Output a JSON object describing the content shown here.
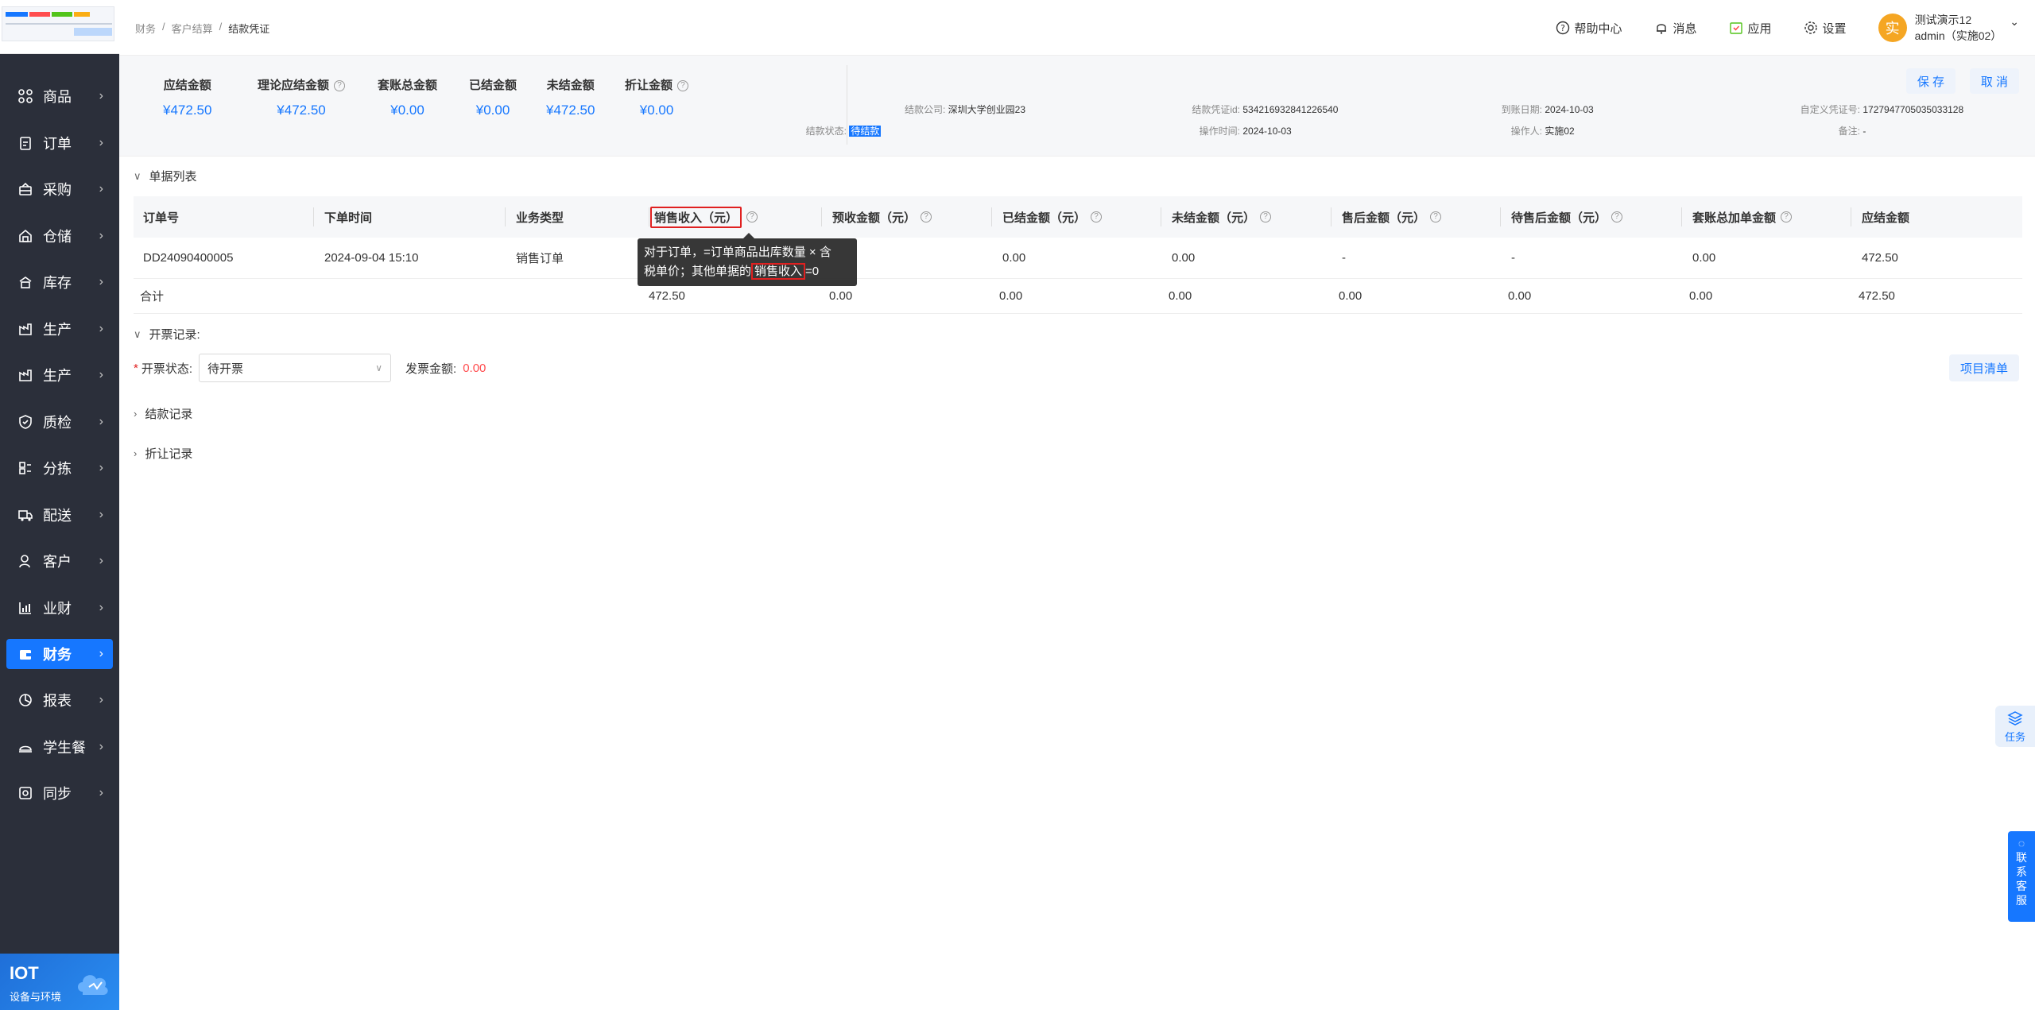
{
  "breadcrumb": [
    "财务",
    "客户结算",
    "结款凭证"
  ],
  "header": {
    "help": "帮助中心",
    "messages": "消息",
    "apps": "应用",
    "settings": "设置",
    "avatar_char": "实",
    "user_name": "测试演示12",
    "user_role": "admin（实施02）"
  },
  "sidebar": {
    "items": [
      {
        "label": "商品",
        "icon": "grid-icon"
      },
      {
        "label": "订单",
        "icon": "clipboard-icon"
      },
      {
        "label": "采购",
        "icon": "basket-icon"
      },
      {
        "label": "仓储",
        "icon": "warehouse-icon"
      },
      {
        "label": "库存",
        "icon": "inventory-icon"
      },
      {
        "label": "生产",
        "icon": "factory-icon"
      },
      {
        "label": "生产",
        "icon": "factory-icon"
      },
      {
        "label": "质检",
        "icon": "shield-icon"
      },
      {
        "label": "分拣",
        "icon": "sort-icon"
      },
      {
        "label": "配送",
        "icon": "truck-icon"
      },
      {
        "label": "客户",
        "icon": "user-icon"
      },
      {
        "label": "业财",
        "icon": "chart-icon"
      },
      {
        "label": "财务",
        "icon": "wallet-icon",
        "active": true
      },
      {
        "label": "报表",
        "icon": "pie-icon"
      },
      {
        "label": "学生餐",
        "icon": "dish-icon"
      },
      {
        "label": "同步",
        "icon": "sync-icon"
      }
    ],
    "brand_title": "IOT",
    "brand_sub": "设备与环境"
  },
  "summary": {
    "metrics": [
      {
        "label": "应结金额",
        "value": "¥472.50",
        "help": false
      },
      {
        "label": "理论应结金额",
        "value": "¥472.50",
        "help": true
      },
      {
        "label": "套账总金额",
        "value": "¥0.00",
        "help": false
      },
      {
        "label": "已结金额",
        "value": "¥0.00",
        "help": false
      },
      {
        "label": "未结金额",
        "value": "¥472.50",
        "help": false
      },
      {
        "label": "折让金额",
        "value": "¥0.00",
        "help": true
      }
    ],
    "info": {
      "company_k": "结款公司:",
      "company_v": "深圳大学创业园23",
      "status_k": "结款状态:",
      "status_v": "待结款",
      "voucher_k": "结款凭证id:",
      "voucher_v": "534216932841226540",
      "optime_k": "操作时间:",
      "optime_v": "2024-10-03",
      "arrive_k": "到账日期:",
      "arrive_v": "2024-10-03",
      "operator_k": "操作人:",
      "operator_v": "实施02",
      "custom_k": "自定义凭证号:",
      "custom_v": "1727947705035033128",
      "remark_k": "备注:",
      "remark_v": "-"
    },
    "save": "保 存",
    "cancel": "取 消"
  },
  "sections": {
    "list": "单据列表",
    "invoice": "开票记录:",
    "settle": "结款记录",
    "discount": "折让记录"
  },
  "table": {
    "headers": [
      "订单号",
      "下单时间",
      "业务类型",
      "销售收入（元）",
      "预收金额（元）",
      "已结金额（元）",
      "未结金额（元）",
      "售后金额（元）",
      "待售后金额（元）",
      "套账总加单金额",
      "应结金额"
    ],
    "row": [
      "DD24090400005",
      "2024-09-04 15:10",
      "销售订单",
      "",
      "",
      "0.00",
      "0.00",
      "-",
      "-",
      "0.00",
      "472.50"
    ],
    "total_label": "合计",
    "total": [
      "472.50",
      "0.00",
      "0.00",
      "0.00",
      "0.00",
      "0.00",
      "0.00",
      "472.50"
    ]
  },
  "tooltip": {
    "line1": "对于订单，=订单商品出库数量 × 含",
    "line2a": "税单价；其他单据的",
    "line2b": "销售收入",
    "line2c": "=0"
  },
  "invoice": {
    "status_label": "开票状态:",
    "status_value": "待开票",
    "amount_label": "发票金额:",
    "amount_value": "0.00",
    "project_btn": "项目清单"
  },
  "floats": {
    "task": "任务",
    "contact": [
      "联",
      "系",
      "客",
      "服"
    ]
  }
}
